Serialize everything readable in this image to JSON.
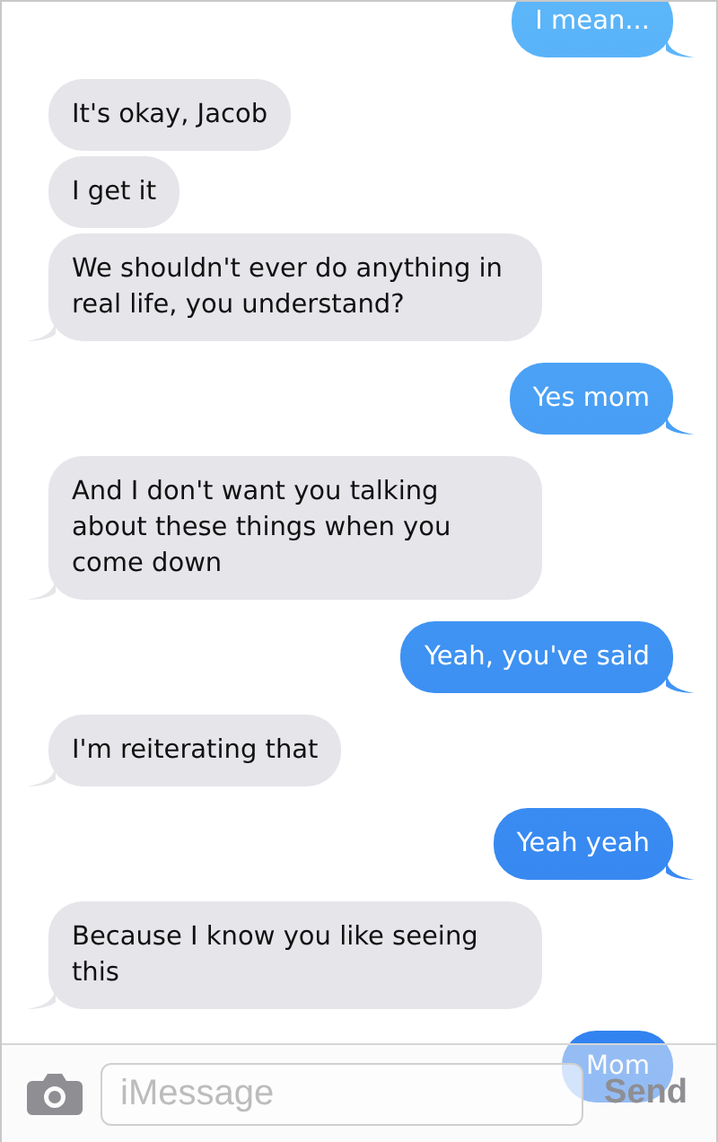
{
  "messages": [
    {
      "text": "I mean...",
      "kind": "sent",
      "tail": true
    },
    {
      "text": "It's okay, Jacob",
      "kind": "received",
      "tail": false
    },
    {
      "text": "I get it",
      "kind": "received",
      "tail": false
    },
    {
      "text": "We shouldn't ever do anything in real life, you understand?",
      "kind": "received",
      "tail": true
    },
    {
      "text": "Yes mom",
      "kind": "sent",
      "tail": true
    },
    {
      "text": "And I don't want you talking about these things when you come down",
      "kind": "received",
      "tail": true
    },
    {
      "text": "Yeah, you've said",
      "kind": "sent",
      "tail": true
    },
    {
      "text": "I'm reiterating that",
      "kind": "received",
      "tail": true
    },
    {
      "text": "Yeah yeah",
      "kind": "sent",
      "tail": true
    },
    {
      "text": "Because I know you like seeing this",
      "kind": "received",
      "tail": true
    },
    {
      "text": "Mom",
      "kind": "sent",
      "tail": false
    }
  ],
  "composer": {
    "placeholder": "iMessage",
    "send": "Send"
  }
}
